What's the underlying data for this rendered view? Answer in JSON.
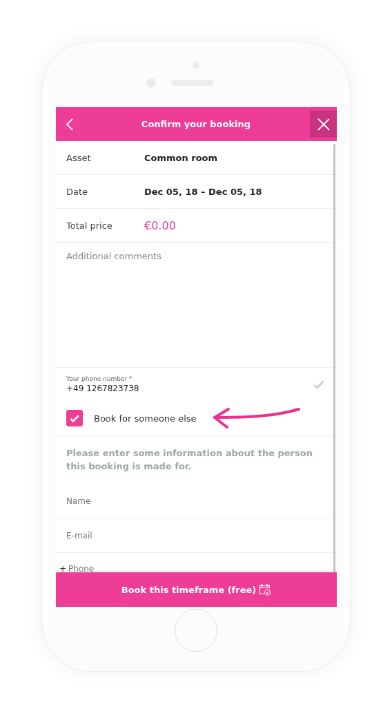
{
  "header": {
    "title": "Confirm your booking"
  },
  "summary": [
    {
      "label": "Asset",
      "value": "Common room",
      "kind": "text"
    },
    {
      "label": "Date",
      "value": "Dec 05, 18 – Dec 05, 18",
      "kind": "text"
    },
    {
      "label": "Total price",
      "value": "€0.00",
      "kind": "price"
    }
  ],
  "comments": {
    "placeholder": "Additional comments"
  },
  "phone": {
    "label": "Your phone number *",
    "value": "+49 1267823738",
    "valid": true
  },
  "book_for_other": {
    "label": "Book for someone else",
    "checked": true
  },
  "info": "Please enter some information about the person this booking is made for.",
  "fields": [
    {
      "placeholder": "Name"
    },
    {
      "placeholder": "E-mail"
    },
    {
      "prefix": "+",
      "placeholder": "Phone"
    }
  ],
  "submit": {
    "label": "Book this timeframe (free)"
  }
}
